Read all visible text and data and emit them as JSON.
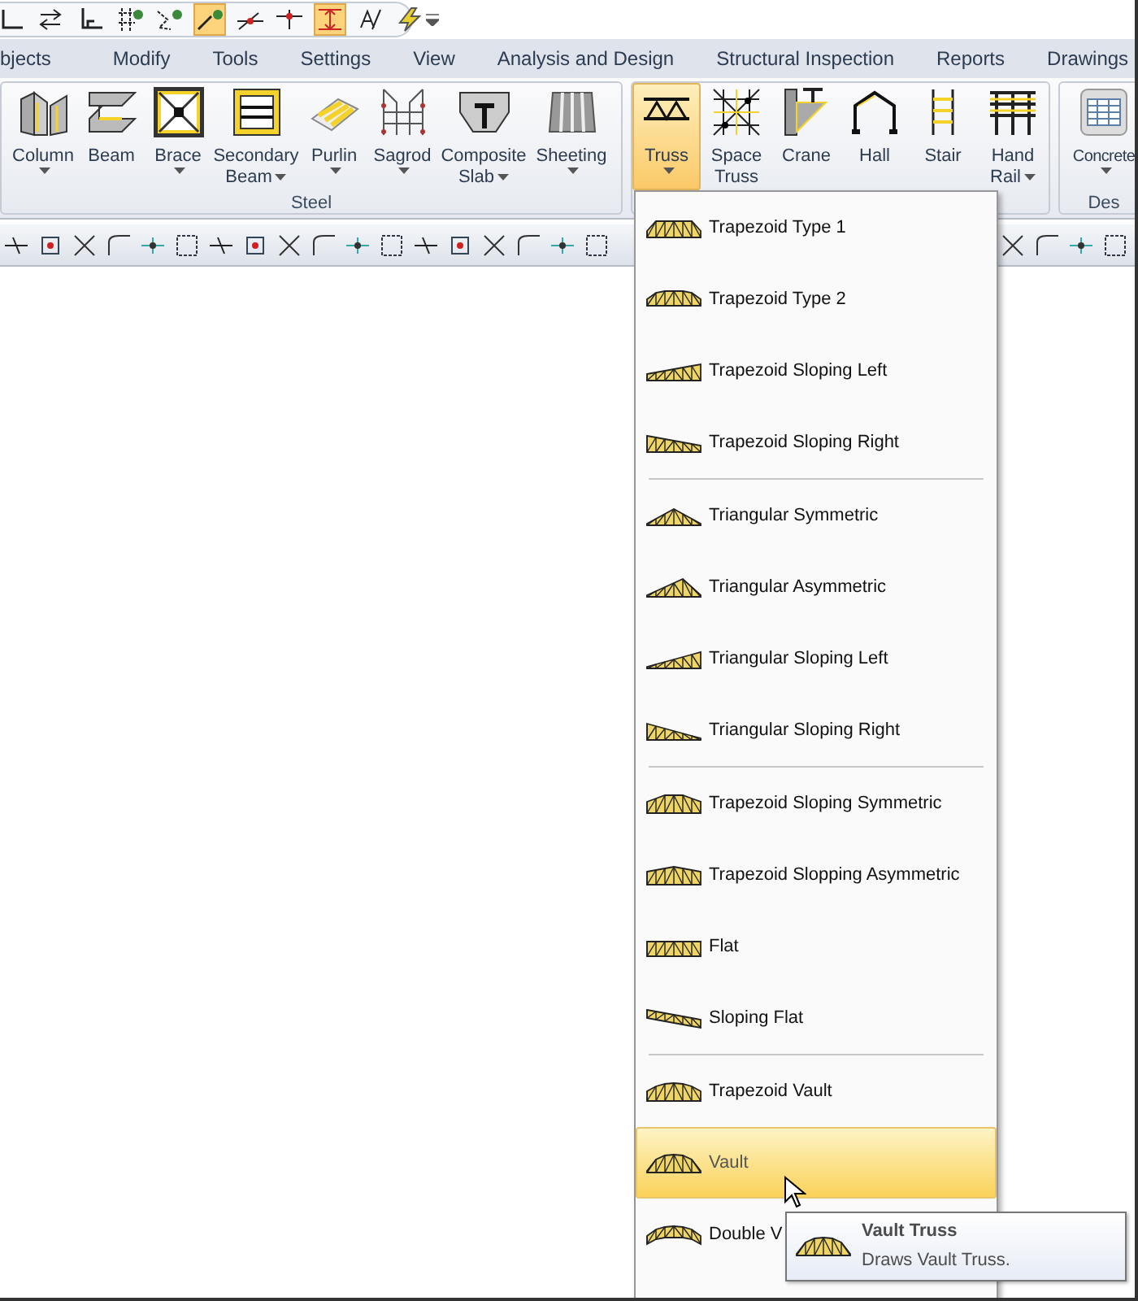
{
  "quick_access": [
    {
      "pressed": false
    },
    {
      "pressed": false
    },
    {
      "pressed": false
    },
    {
      "pressed": false
    },
    {
      "pressed": false
    },
    {
      "pressed": true
    },
    {
      "pressed": false
    },
    {
      "pressed": false
    },
    {
      "pressed": true
    },
    {
      "pressed": false
    },
    {
      "pressed": false
    }
  ],
  "menu_tabs": [
    "bjects",
    "Modify",
    "Tools",
    "Settings",
    "View",
    "Analysis and Design",
    "Structural Inspection",
    "Reports",
    "Drawings"
  ],
  "ribbon": [
    {
      "label": "Steel",
      "buttons": [
        {
          "lines": [
            "Column"
          ],
          "dropdown": true,
          "pressed": false
        },
        {
          "lines": [
            "Beam"
          ],
          "dropdown": false,
          "pressed": false
        },
        {
          "lines": [
            "Brace"
          ],
          "dropdown": true,
          "pressed": false
        },
        {
          "lines": [
            "Secondary",
            "Beam"
          ],
          "dropdown": true,
          "pressed": false
        },
        {
          "lines": [
            "Purlin"
          ],
          "dropdown": true,
          "pressed": false
        },
        {
          "lines": [
            "Sagrod"
          ],
          "dropdown": true,
          "pressed": false
        },
        {
          "lines": [
            "Composite",
            "Slab"
          ],
          "dropdown": true,
          "pressed": false
        },
        {
          "lines": [
            "Sheeting"
          ],
          "dropdown": true,
          "pressed": false
        }
      ]
    },
    {
      "buttons": [
        {
          "lines": [
            "Truss"
          ],
          "dropdown": true,
          "pressed": true
        },
        {
          "lines": [
            "Space",
            "Truss"
          ],
          "dropdown": false,
          "pressed": false
        },
        {
          "lines": [
            "Crane"
          ],
          "dropdown": false,
          "pressed": false
        },
        {
          "lines": [
            "Hall"
          ],
          "dropdown": false,
          "pressed": false
        },
        {
          "lines": [
            "Stair"
          ],
          "dropdown": false,
          "pressed": false
        },
        {
          "lines": [
            "Hand",
            "Rail"
          ],
          "dropdown": true,
          "pressed": false
        }
      ]
    },
    {
      "label": "Des",
      "buttons": [
        {
          "lines": [
            "Concrete"
          ],
          "dropdown": true,
          "pressed": false
        }
      ]
    }
  ],
  "truss_menu": [
    [
      {
        "label": "Trapezoid Type 1",
        "selected": false
      },
      {
        "label": "Trapezoid Type 2",
        "selected": false
      },
      {
        "label": "Trapezoid Sloping Left",
        "selected": false
      },
      {
        "label": "Trapezoid Sloping Right",
        "selected": false
      }
    ],
    [
      {
        "label": "Triangular Symmetric",
        "selected": false
      },
      {
        "label": "Triangular Asymmetric",
        "selected": false
      },
      {
        "label": "Triangular Sloping Left",
        "selected": false
      },
      {
        "label": "Triangular Sloping Right",
        "selected": false
      }
    ],
    [
      {
        "label": "Trapezoid Sloping Symmetric",
        "selected": false
      },
      {
        "label": "Trapezoid Slopping Asymmetric",
        "selected": false
      },
      {
        "label": "Flat",
        "selected": false
      },
      {
        "label": "Sloping Flat",
        "selected": false
      }
    ],
    [
      {
        "label": "Trapezoid Vault",
        "selected": false
      },
      {
        "label": "Vault",
        "selected": true
      },
      {
        "label": "Double V",
        "selected": false
      }
    ]
  ],
  "tooltip": {
    "title": "Vault Truss",
    "text": "Draws Vault Truss."
  }
}
